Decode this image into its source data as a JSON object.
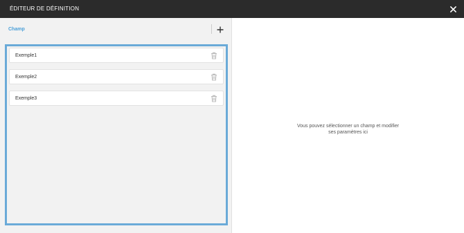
{
  "header": {
    "title": "ÉDITEUR DE DÉFINITION",
    "close_icon": "close-icon"
  },
  "left_panel": {
    "label": "Champ",
    "add_icon": "plus-icon",
    "fields": [
      {
        "name": "Exemple1",
        "icon": "trash-icon"
      },
      {
        "name": "Exemple2",
        "icon": "trash-icon"
      },
      {
        "name": "Exemple3",
        "icon": "trash-icon"
      }
    ]
  },
  "right_panel": {
    "hint_line1": "Vous pouvez sélectionner un champ et modifier",
    "hint_line2": "ses paramètres ici"
  },
  "colors": {
    "header_bg": "#2b2b2b",
    "accent": "#4a9fd8",
    "selection_border": "#6aaad8",
    "panel_bg": "#f2f2f2"
  }
}
